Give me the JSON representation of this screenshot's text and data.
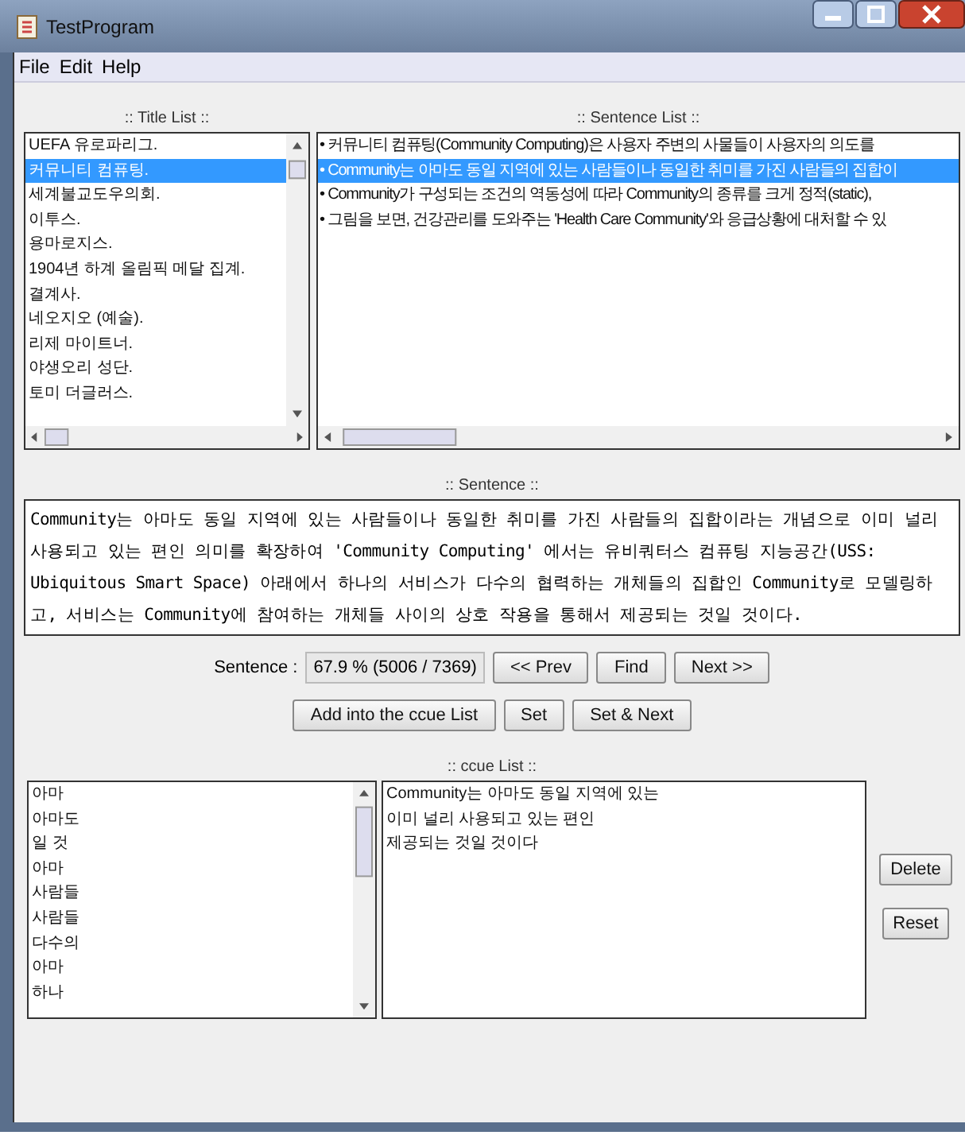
{
  "window": {
    "title": "TestProgram"
  },
  "menu": [
    "File",
    "Edit",
    "Help"
  ],
  "title_list": {
    "heading": ":: Title List ::",
    "items": [
      {
        "text": "UEFA 유로파리그.",
        "selected": false
      },
      {
        "text": "커뮤니티 컴퓨팅.",
        "selected": true
      },
      {
        "text": "세계불교도우의회.",
        "selected": false
      },
      {
        "text": "이투스.",
        "selected": false
      },
      {
        "text": "용마로지스.",
        "selected": false
      },
      {
        "text": "1904년 하계 올림픽 메달 집계.",
        "selected": false
      },
      {
        "text": "결계사.",
        "selected": false
      },
      {
        "text": "네오지오 (예술).",
        "selected": false
      },
      {
        "text": "리제 마이트너.",
        "selected": false
      },
      {
        "text": "야생오리 성단.",
        "selected": false
      },
      {
        "text": "토미 더글러스.",
        "selected": false
      }
    ]
  },
  "sentence_list": {
    "heading": ":: Sentence List ::",
    "items": [
      {
        "text": "• 커뮤니티 컴퓨팅(Community Computing)은 사용자 주변의 사물들이 사용자의 의도를",
        "selected": false
      },
      {
        "text": "• Community는 아마도 동일 지역에 있는 사람들이나 동일한 취미를 가진 사람들의 집합이",
        "selected": true
      },
      {
        "text": "• Community가 구성되는 조건의 역동성에 따라 Community의 종류를 크게 정적(static),",
        "selected": false
      },
      {
        "text": "• 그림을 보면, 건강관리를 도와주는 'Health Care Community'와 응급상황에 대처할 수 있",
        "selected": false
      }
    ]
  },
  "sentence": {
    "heading": ":: Sentence ::",
    "text": "Community는 아마도 동일 지역에 있는 사람들이나 동일한 취미를 가진 사람들의 집합이라는 개념으로 이미 널리 사용되고 있는 편인 의미를 확장하여  'Community Computing' 에서는 유비쿼터스 컴퓨팅 지능공간(USS: Ubiquitous Smart Space) 아래에서 하나의 서비스가 다수의 협력하는 개체들의 집합인 Community로 모델링하고, 서비스는 Community에 참여하는 개체들 사이의 상호 작용을 통해서 제공되는 것일 것이다."
  },
  "progress": {
    "label": "Sentence :",
    "value": "67.9 %  (5006 / 7369)"
  },
  "nav_buttons": [
    "<< Prev",
    "Find",
    "Next >>"
  ],
  "action_buttons": [
    "Add into the ccue List",
    "Set",
    "Set & Next"
  ],
  "ccue": {
    "heading": ":: ccue List ::",
    "words": [
      "아마",
      "아마도",
      "일 것",
      "아마",
      "사람들",
      "사람들",
      "다수의",
      "아마",
      "하나"
    ],
    "phrases": [
      "Community는 아마도 동일 지역에 있는",
      "이미 널리 사용되고 있는 편인",
      "제공되는 것일 것이다"
    ],
    "buttons": [
      "Delete",
      "Reset"
    ]
  }
}
